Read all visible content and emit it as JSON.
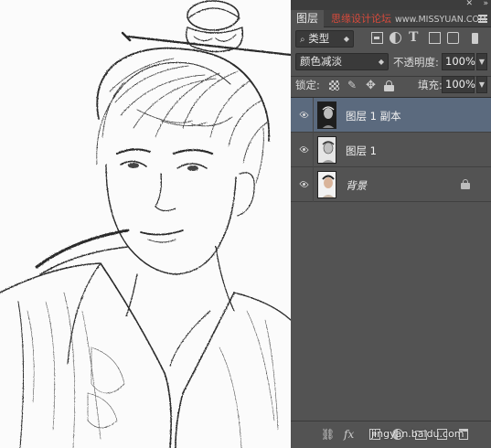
{
  "canvas": {
    "image_alt": "pencil-sketch portrait of a man with a topknot in period costume"
  },
  "panel": {
    "tab_label": "图层",
    "watermark_site": "思缘设计论坛",
    "watermark_url": "www.MISSYUAN.COM",
    "filter": {
      "label": "类型",
      "icons": [
        "pixel-filter-icon",
        "adjustment-filter-icon",
        "type-filter-icon",
        "shape-filter-icon",
        "smart-object-filter-icon"
      ]
    },
    "blend_mode": "颜色减淡",
    "opacity_label": "不透明度:",
    "opacity_value": "100%",
    "lock_label": "锁定:",
    "fill_label": "填充:",
    "fill_value": "100%",
    "layers": [
      {
        "name": "图层 1 副本",
        "selected": true,
        "visible": true,
        "locked": false,
        "italic": false,
        "thumb": "dark"
      },
      {
        "name": "图层 1",
        "selected": false,
        "visible": true,
        "locked": false,
        "italic": false,
        "thumb": "light"
      },
      {
        "name": "背景",
        "selected": false,
        "visible": true,
        "locked": true,
        "italic": true,
        "thumb": "color"
      }
    ],
    "bottom_watermark": "jingyan.baidu.com"
  },
  "colors": {
    "panel_bg": "#535353",
    "selected_row": "#5b6a7e",
    "watermark_red": "#d84a3c"
  }
}
